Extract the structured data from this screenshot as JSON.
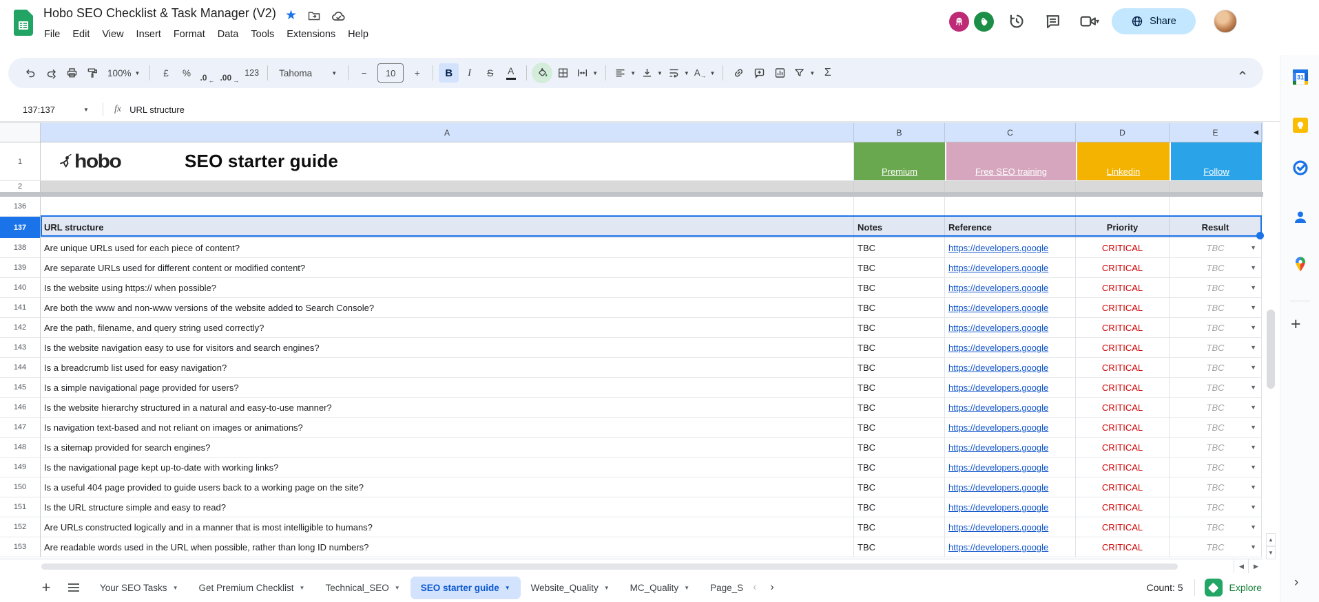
{
  "titlebar": {
    "title": "Hobo SEO Checklist & Task Manager (V2)",
    "menus": [
      "File",
      "Edit",
      "View",
      "Insert",
      "Format",
      "Data",
      "Tools",
      "Extensions",
      "Help"
    ],
    "share_label": "Share"
  },
  "toolbar": {
    "zoom": "100%",
    "currency": "£",
    "percent": "%",
    "decrease_decimal": ".0",
    "increase_decimal": ".00",
    "more_formats": "123",
    "font_name": "Tahoma",
    "font_size": "10",
    "minus": "−",
    "plus": "+",
    "bold": "B",
    "italic": "I",
    "strikethrough": "S",
    "text_color": "A",
    "rotate_letter": "A",
    "sigma": "Σ"
  },
  "formula_bar": {
    "name_box": "137:137",
    "fx": "fx",
    "value": "URL structure"
  },
  "grid": {
    "column_letters": [
      "A",
      "B",
      "C",
      "D",
      "E"
    ],
    "banner": {
      "num": "1",
      "logo": "hobo",
      "title": "SEO starter guide",
      "links": [
        {
          "label": "Premium",
          "color": "#6aa84f"
        },
        {
          "label": "Free SEO training",
          "color": "#d5a6bd"
        },
        {
          "label": "Linkedin",
          "color": "#f3b300"
        },
        {
          "label": "Follow",
          "color": "#2aa3e9"
        }
      ]
    },
    "row2": {
      "num": "2"
    },
    "row136": {
      "num": "136"
    },
    "header_row": {
      "num": "137",
      "section": "URL structure",
      "notes": "Notes",
      "reference": "Reference",
      "priority": "Priority",
      "result": "Result"
    },
    "link_color": "#1155cc",
    "priority_color": "#cc0000",
    "rows": [
      {
        "num": "138",
        "question": "Are unique URLs used for each piece of content?",
        "notes": "TBC",
        "reference": "https://developers.google",
        "priority": "CRITICAL",
        "result": "TBC"
      },
      {
        "num": "139",
        "question": "Are separate URLs used for different content or modified content?",
        "notes": "TBC",
        "reference": "https://developers.google",
        "priority": "CRITICAL",
        "result": "TBC"
      },
      {
        "num": "140",
        "question": "Is the website using https:// when possible?",
        "notes": "TBC",
        "reference": "https://developers.google",
        "priority": "CRITICAL",
        "result": "TBC"
      },
      {
        "num": "141",
        "question": "Are both the www and non-www versions of the website added to Search Console?",
        "notes": "TBC",
        "reference": "https://developers.google",
        "priority": "CRITICAL",
        "result": "TBC"
      },
      {
        "num": "142",
        "question": "Are the path, filename, and query string used correctly?",
        "notes": "TBC",
        "reference": "https://developers.google",
        "priority": "CRITICAL",
        "result": "TBC"
      },
      {
        "num": "143",
        "question": "Is the website navigation easy to use for visitors and search engines?",
        "notes": "TBC",
        "reference": "https://developers.google",
        "priority": "CRITICAL",
        "result": "TBC"
      },
      {
        "num": "144",
        "question": "Is a breadcrumb list used for easy navigation?",
        "notes": "TBC",
        "reference": "https://developers.google",
        "priority": "CRITICAL",
        "result": "TBC"
      },
      {
        "num": "145",
        "question": "Is a simple navigational page provided for users?",
        "notes": "TBC",
        "reference": "https://developers.google",
        "priority": "CRITICAL",
        "result": "TBC"
      },
      {
        "num": "146",
        "question": "Is the website hierarchy structured in a natural and easy-to-use manner?",
        "notes": "TBC",
        "reference": "https://developers.google",
        "priority": "CRITICAL",
        "result": "TBC"
      },
      {
        "num": "147",
        "question": "Is navigation text-based and not reliant on images or animations?",
        "notes": "TBC",
        "reference": "https://developers.google",
        "priority": "CRITICAL",
        "result": "TBC"
      },
      {
        "num": "148",
        "question": "Is a sitemap provided for search engines?",
        "notes": "TBC",
        "reference": "https://developers.google",
        "priority": "CRITICAL",
        "result": "TBC"
      },
      {
        "num": "149",
        "question": "Is the navigational page kept up-to-date with working links?",
        "notes": "TBC",
        "reference": "https://developers.google",
        "priority": "CRITICAL",
        "result": "TBC"
      },
      {
        "num": "150",
        "question": "Is a useful 404 page provided to guide users back to a working page on the site?",
        "notes": "TBC",
        "reference": "https://developers.google",
        "priority": "CRITICAL",
        "result": "TBC"
      },
      {
        "num": "151",
        "question": "Is the URL structure simple and easy to read?",
        "notes": "TBC",
        "reference": "https://developers.google",
        "priority": "CRITICAL",
        "result": "TBC"
      },
      {
        "num": "152",
        "question": "Are URLs constructed logically and in a manner that is most intelligible to humans?",
        "notes": "TBC",
        "reference": "https://developers.google",
        "priority": "CRITICAL",
        "result": "TBC"
      },
      {
        "num": "153",
        "question": "Are readable words used in the URL when possible, rather than long ID numbers?",
        "notes": "TBC",
        "reference": "https://developers.google",
        "priority": "CRITICAL",
        "result": "TBC"
      }
    ]
  },
  "side_panel": {
    "icons": [
      "google-calendar",
      "google-keep",
      "google-tasks",
      "google-contacts",
      "google-maps",
      "get-add-ons"
    ]
  },
  "tabbar": {
    "tabs": [
      {
        "label": "Your SEO Tasks"
      },
      {
        "label": "Get Premium Checklist"
      },
      {
        "label": "Technical_SEO"
      },
      {
        "label": "SEO starter guide",
        "active": true
      },
      {
        "label": "Website_Quality"
      },
      {
        "label": "MC_Quality"
      },
      {
        "label": "Page_S"
      }
    ],
    "count": "Count: 5",
    "explore": "Explore"
  }
}
